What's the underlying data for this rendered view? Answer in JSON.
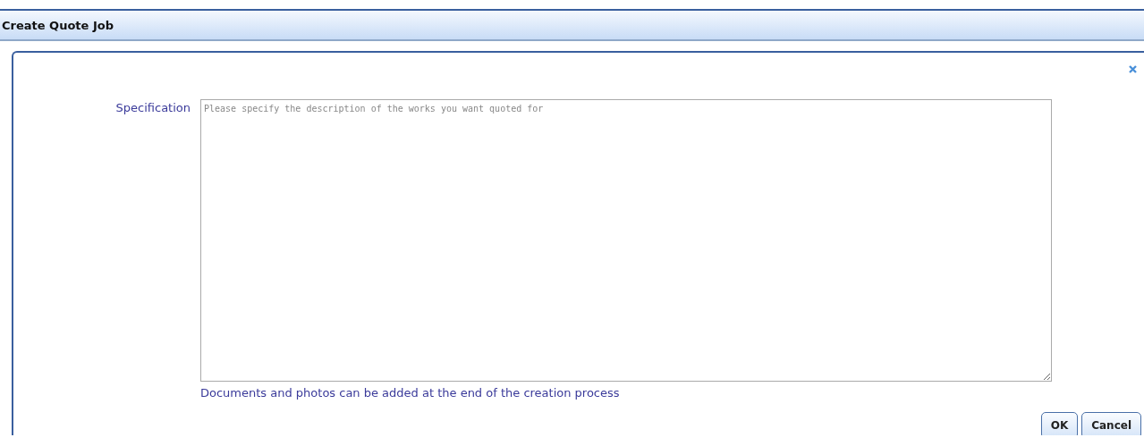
{
  "window": {
    "title": "Create Quote Job"
  },
  "form": {
    "label": "Specification",
    "placeholder": "Please specify the description of the works you want quoted for",
    "note": "Documents and photos can be added at the end of the creation process"
  },
  "buttons": [
    "OK",
    "Cancel"
  ]
}
